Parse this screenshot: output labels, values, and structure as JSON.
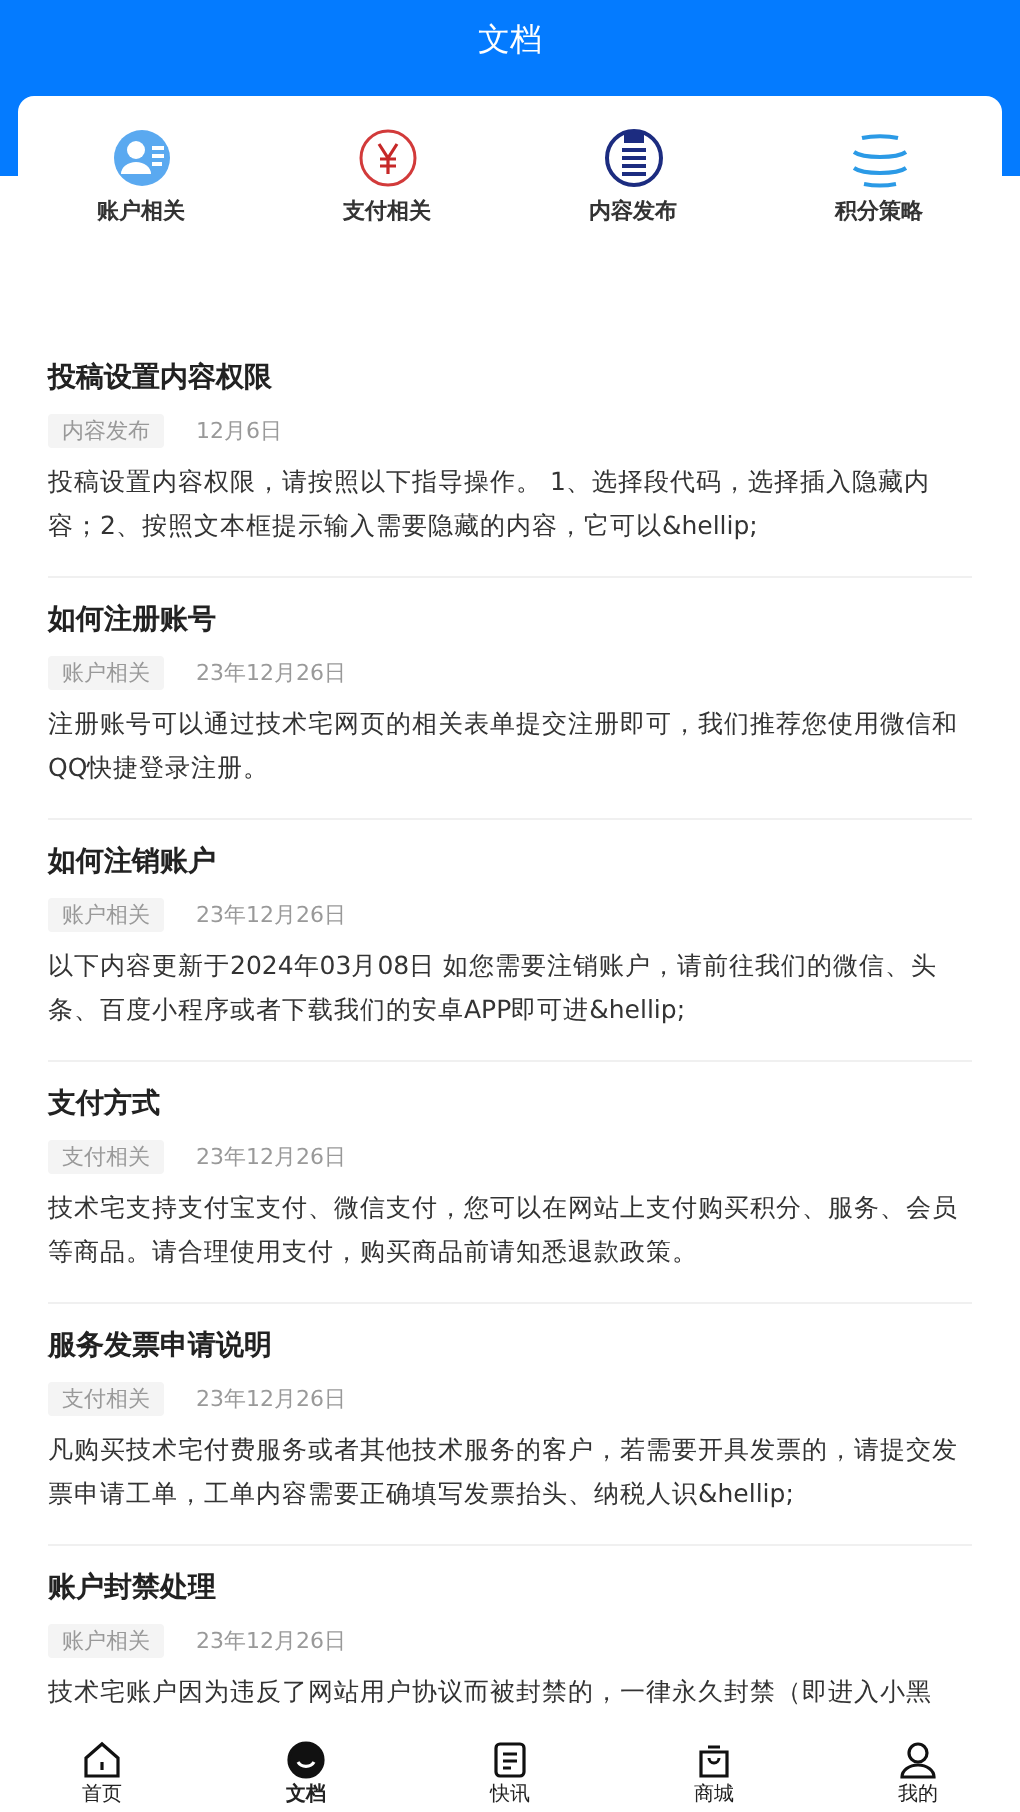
{
  "header": {
    "title": "文档"
  },
  "categories": [
    {
      "label": "账户相关"
    },
    {
      "label": "支付相关"
    },
    {
      "label": "内容发布"
    },
    {
      "label": "积分策略"
    }
  ],
  "articles": [
    {
      "title": "投稿设置内容权限",
      "tag": "内容发布",
      "date": "12月6日",
      "summary": "投稿设置内容权限，请按照以下指导操作。 1、选择段代码，选择插入隐藏内容；2、按照文本框提示输入需要隐藏的内容，它可以&hellip;"
    },
    {
      "title": "如何注册账号",
      "tag": "账户相关",
      "date": "23年12月26日",
      "summary": "注册账号可以通过技术宅网页的相关表单提交注册即可，我们推荐您使用微信和QQ快捷登录注册。"
    },
    {
      "title": "如何注销账户",
      "tag": "账户相关",
      "date": "23年12月26日",
      "summary": "以下内容更新于2024年03月08日 如您需要注销账户，请前往我们的微信、头条、百度小程序或者下载我们的安卓APP即可进&hellip;"
    },
    {
      "title": "支付方式",
      "tag": "支付相关",
      "date": "23年12月26日",
      "summary": "技术宅支持支付宝支付、微信支付，您可以在网站上支付购买积分、服务、会员等商品。请合理使用支付，购买商品前请知悉退款政策。"
    },
    {
      "title": "服务发票申请说明",
      "tag": "支付相关",
      "date": "23年12月26日",
      "summary": "凡购买技术宅付费服务或者其他技术服务的客户，若需要开具发票的，请提交发票申请工单，工单内容需要正确填写发票抬头、纳税人识&hellip;"
    },
    {
      "title": "账户封禁处理",
      "tag": "账户相关",
      "date": "23年12月26日",
      "summary": "技术宅账户因为违反了网站用户协议而被封禁的，一律永久封禁（即进入小黑"
    }
  ],
  "tab_bar": [
    {
      "label": "首页",
      "selected": false
    },
    {
      "label": "文档",
      "selected": true
    },
    {
      "label": "快讯",
      "selected": false
    },
    {
      "label": "商城",
      "selected": false
    },
    {
      "label": "我的",
      "selected": false
    }
  ]
}
